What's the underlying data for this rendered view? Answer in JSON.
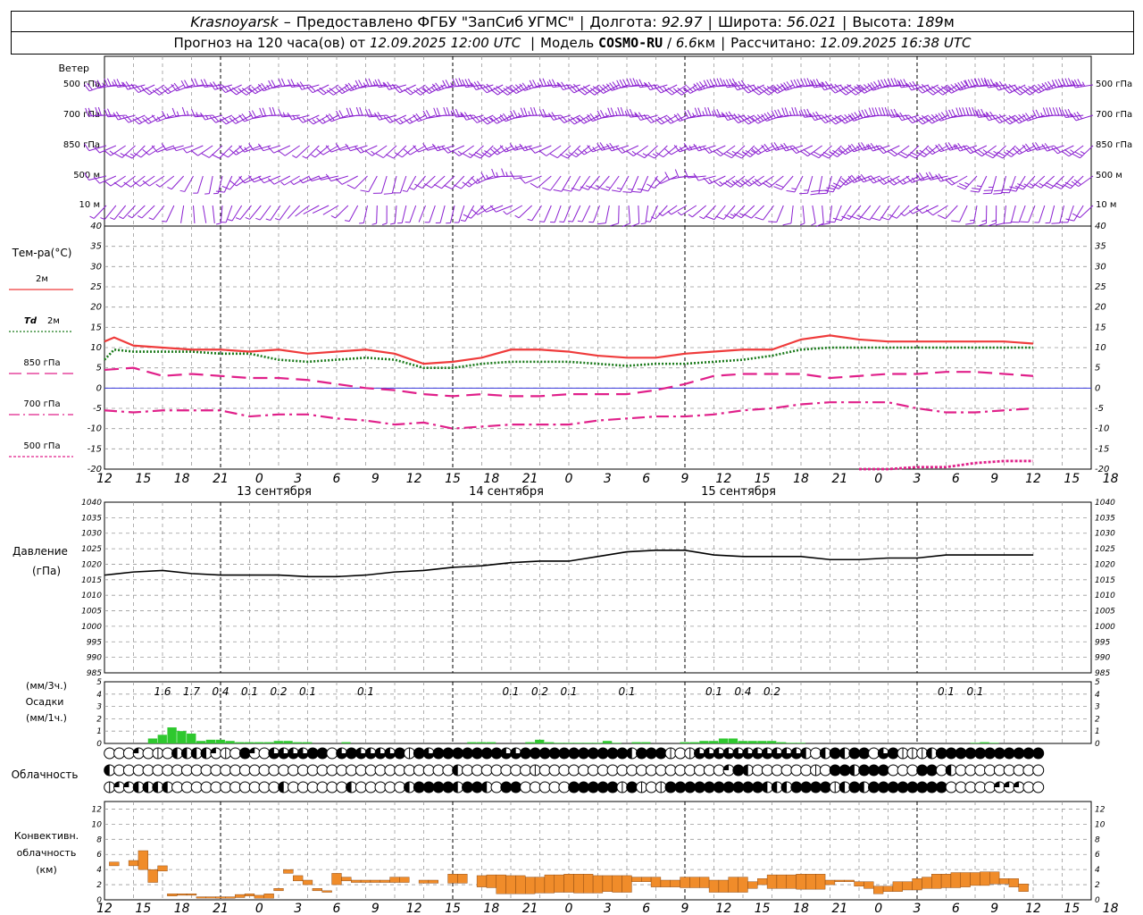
{
  "header": {
    "city": "Krasnoyarsk",
    "dash": "–",
    "provider": "Предоставлено ФГБУ \"ЗапСиб УГМС\"",
    "lon_label": "Долгота:",
    "lon_value": "92.97",
    "lat_label": "Широта:",
    "lat_value": "56.021",
    "alt_label": "Высота:",
    "alt_value": "189",
    "alt_unit": "м",
    "forecast_label": "Прогноз на 120 часа(ов) от",
    "forecast_from": "12.09.2025 12:00 UTC",
    "model_label": "Модель",
    "model_name": "COSMO-RU",
    "model_res": "6.6",
    "model_res_unit": "км",
    "calc_label": "Рассчитано:",
    "calc_time": "12.09.2025 16:38 UTC"
  },
  "colors": {
    "t2m": "#ef3b3b",
    "td2m": "#1a7a1a",
    "t850": "#e0208a",
    "t700": "#e0208a",
    "t500": "#e0208a",
    "wind": "#8a1fd0",
    "zero_line": "#3a3adc",
    "precip": "#2ec82e",
    "convective": "#f08c2a",
    "pressure": "#000000"
  },
  "x_axis": {
    "hour_ticks": [
      "12",
      "15",
      "18",
      "21",
      "0",
      "3",
      "6",
      "9",
      "12",
      "15",
      "18",
      "21",
      "0",
      "3",
      "6",
      "9",
      "12",
      "15",
      "18",
      "21",
      "0",
      "3",
      "6",
      "9",
      "12",
      "15",
      "18"
    ],
    "date_labels": [
      "13 сентября",
      "14 сентября",
      "15 сентября"
    ]
  },
  "wind_panel": {
    "title": "Ветер",
    "levels": [
      "500 гПа",
      "700 гПа",
      "850 гПа",
      "500 м",
      "10 м"
    ]
  },
  "temp_panel": {
    "title": "Тем-ра(°С)",
    "legend": [
      {
        "label": "2м",
        "style": "solid"
      },
      {
        "label_italic": "Td",
        "label": "2м",
        "style": "dotted"
      },
      {
        "label": "850 гПа",
        "style": "dashed"
      },
      {
        "label": "700 гПа",
        "style": "dashdot"
      },
      {
        "label": "500 гПа",
        "style": "densedot"
      }
    ],
    "yticks": [
      "40",
      "35",
      "30",
      "25",
      "20",
      "15",
      "10",
      "5",
      "0",
      "-5",
      "-10",
      "-15",
      "-20"
    ]
  },
  "pressure_panel": {
    "title": "Давление",
    "unit": "(гПа)",
    "yticks": [
      "1040",
      "1035",
      "1030",
      "1025",
      "1020",
      "1015",
      "1010",
      "1005",
      "1000",
      "995",
      "990",
      "985"
    ]
  },
  "precip_panel": {
    "unit3": "(мм/3ч.)",
    "title": "Осадки",
    "unit1": "(мм/1ч.)",
    "yticks": [
      "5",
      "4",
      "3",
      "2",
      "1",
      "0"
    ],
    "labels": [
      {
        "h": 6,
        "text": "1.6"
      },
      {
        "h": 9,
        "text": "1.7"
      },
      {
        "h": 12,
        "text": "0.4"
      },
      {
        "h": 15,
        "text": "0.1"
      },
      {
        "h": 18,
        "text": "0.2"
      },
      {
        "h": 21,
        "text": "0.1"
      },
      {
        "h": 27,
        "text": "0.1"
      },
      {
        "h": 42,
        "text": "0.1"
      },
      {
        "h": 45,
        "text": "0.2"
      },
      {
        "h": 48,
        "text": "0.1"
      },
      {
        "h": 54,
        "text": "0.1"
      },
      {
        "h": 63,
        "text": "0.1"
      },
      {
        "h": 66,
        "text": "0.4"
      },
      {
        "h": 69,
        "text": "0.2"
      },
      {
        "h": 87,
        "text": "0.1"
      },
      {
        "h": 90,
        "text": "0.1"
      }
    ]
  },
  "cloud_panel": {
    "title": "Облачность"
  },
  "conv_panel": {
    "title1": "Конвективн.",
    "title2": "облачность",
    "unit": "(км)",
    "yticks": [
      "12",
      "10",
      "8",
      "6",
      "4",
      "2",
      "0"
    ]
  },
  "chart_data": [
    {
      "type": "line",
      "title": "Тем-ра(°С)",
      "x_unit": "hours from 12.09.2025 12:00 UTC",
      "ylim": [
        -20,
        40
      ],
      "series": [
        {
          "name": "2м",
          "x": [
            0,
            1,
            3,
            6,
            9,
            12,
            15,
            18,
            21,
            24,
            27,
            30,
            33,
            36,
            39,
            42,
            45,
            48,
            51,
            54,
            57,
            60,
            63,
            66,
            69,
            72,
            75,
            78,
            81,
            84,
            87,
            90,
            93,
            96
          ],
          "values": [
            11.5,
            12.5,
            10.5,
            10,
            9.5,
            9.5,
            9,
            9.5,
            8.5,
            9,
            9.5,
            8.5,
            6,
            6.5,
            7.5,
            9.5,
            9.5,
            9,
            8,
            7.5,
            7.5,
            8.5,
            9,
            9.5,
            9.5,
            12,
            13,
            12,
            11.5,
            11.5,
            11.5,
            11.5,
            11.5,
            11
          ]
        },
        {
          "name": "Td 2м",
          "x": [
            0,
            1,
            3,
            6,
            9,
            12,
            15,
            18,
            21,
            24,
            27,
            30,
            33,
            36,
            39,
            42,
            45,
            48,
            51,
            54,
            57,
            60,
            63,
            66,
            69,
            72,
            75,
            78,
            81,
            84,
            87,
            90,
            93,
            96
          ],
          "values": [
            7,
            9.5,
            9,
            9,
            9,
            8.5,
            8.5,
            7,
            6.5,
            7,
            7.5,
            7,
            5,
            5,
            6,
            6.5,
            6.5,
            6.5,
            6,
            5.5,
            6,
            6,
            6.5,
            7,
            8,
            9.5,
            10,
            10,
            10,
            10,
            10,
            10,
            10,
            10
          ]
        },
        {
          "name": "850 гПа",
          "x": [
            0,
            3,
            6,
            9,
            12,
            15,
            18,
            21,
            24,
            27,
            30,
            33,
            36,
            39,
            42,
            45,
            48,
            51,
            54,
            57,
            60,
            63,
            66,
            69,
            72,
            75,
            78,
            81,
            84,
            87,
            90,
            93,
            96
          ],
          "values": [
            4.5,
            5,
            3,
            3.5,
            3,
            2.5,
            2.5,
            2,
            1,
            0,
            -0.5,
            -1.5,
            -2,
            -1.5,
            -2,
            -2,
            -1.5,
            -1.5,
            -1.5,
            -0.5,
            1,
            3,
            3.5,
            3.5,
            3.5,
            2.5,
            3,
            3.5,
            3.5,
            4,
            4,
            3.5,
            3
          ]
        },
        {
          "name": "700 гПа",
          "x": [
            0,
            3,
            6,
            9,
            12,
            15,
            18,
            21,
            24,
            27,
            30,
            33,
            36,
            39,
            42,
            45,
            48,
            51,
            54,
            57,
            60,
            63,
            66,
            69,
            72,
            75,
            78,
            81,
            84,
            87,
            90,
            93,
            96
          ],
          "values": [
            -5.5,
            -6,
            -5.5,
            -5.5,
            -5.5,
            -7,
            -6.5,
            -6.5,
            -7.5,
            -8,
            -9,
            -8.5,
            -10,
            -9.5,
            -9,
            -9,
            -9,
            -8,
            -7.5,
            -7,
            -7,
            -6.5,
            -5.5,
            -5,
            -4,
            -3.5,
            -3.5,
            -3.5,
            -5,
            -6,
            -6,
            -5.5,
            -5
          ]
        },
        {
          "name": "500 гПа",
          "x": [
            78,
            81,
            84,
            87,
            90,
            93,
            96
          ],
          "values": [
            -20,
            -20,
            -19.5,
            -19.5,
            -18.5,
            -18,
            -18
          ]
        }
      ]
    },
    {
      "type": "line",
      "title": "Давление",
      "ylabel": "(гПа)",
      "ylim": [
        985,
        1040
      ],
      "series": [
        {
          "name": "Давление",
          "x": [
            0,
            3,
            6,
            9,
            12,
            15,
            18,
            21,
            24,
            27,
            30,
            33,
            36,
            39,
            42,
            45,
            48,
            51,
            54,
            57,
            60,
            63,
            66,
            69,
            72,
            75,
            78,
            81,
            84,
            87,
            90,
            93,
            96
          ],
          "values": [
            1016.5,
            1017.5,
            1018,
            1017,
            1016.5,
            1016.5,
            1016.5,
            1016,
            1016,
            1016.5,
            1017.5,
            1018,
            1019,
            1019.5,
            1020.5,
            1021,
            1021,
            1022.5,
            1024,
            1024.5,
            1024.5,
            1023,
            1022.5,
            1022.5,
            1022.5,
            1021.5,
            1021.5,
            1022,
            1022,
            1023,
            1023,
            1023,
            1023
          ]
        }
      ]
    },
    {
      "type": "bar",
      "title": "Осадки",
      "ylabel": "(мм/1ч.)",
      "ylim": [
        0,
        5
      ],
      "series": [
        {
          "name": "Осадки",
          "x": [
            5,
            6,
            7,
            8,
            9,
            10,
            11,
            12,
            13,
            14,
            15,
            16,
            17,
            18,
            19,
            20,
            21,
            25,
            38,
            39,
            40,
            44,
            45,
            46,
            47,
            48,
            49,
            50,
            51,
            52,
            53,
            55,
            56,
            60,
            61,
            62,
            63,
            64,
            65,
            66,
            67,
            68,
            69,
            70,
            71,
            72,
            90,
            91,
            92
          ],
          "values": [
            0.4,
            0.7,
            1.3,
            1.0,
            0.8,
            0.2,
            0.3,
            0.3,
            0.2,
            0.1,
            0.1,
            0.1,
            0.1,
            0.2,
            0.2,
            0.1,
            0.1,
            0.1,
            0.1,
            0.1,
            0.1,
            0.1,
            0.3,
            0.1,
            0.05,
            0.05,
            0.05,
            0.05,
            0.05,
            0.2,
            0.05,
            0.1,
            0.1,
            0.1,
            0.1,
            0.2,
            0.2,
            0.4,
            0.4,
            0.2,
            0.2,
            0.2,
            0.2,
            0.1,
            0.05,
            0.05,
            0.05,
            0.1,
            0.05
          ]
        }
      ]
    },
    {
      "type": "bar",
      "title": "Конвективн. облачность",
      "ylabel": "(км)",
      "ylim": [
        0,
        13
      ],
      "series": [
        {
          "name": "нижняя",
          "x": [
            1,
            3,
            4,
            5,
            6,
            7,
            8,
            9,
            10,
            11,
            12,
            13,
            14,
            15,
            16,
            17,
            18,
            19,
            20,
            21,
            22,
            23,
            24,
            25,
            26,
            27,
            28,
            29,
            30,
            31,
            33,
            34,
            36,
            37,
            39,
            40,
            41,
            42,
            43,
            44,
            45,
            46,
            47,
            48,
            49,
            50,
            51,
            52,
            53,
            54,
            55,
            56,
            57,
            58,
            59,
            60,
            61,
            62,
            63,
            64,
            65,
            66,
            67,
            68,
            69,
            70,
            71,
            72,
            73,
            74,
            75,
            76,
            77,
            78,
            79,
            80,
            81,
            82,
            83,
            84,
            85,
            86,
            87,
            88,
            89,
            90,
            91,
            92,
            93,
            94,
            95
          ],
          "bottom": [
            4.5,
            4.5,
            4,
            2.3,
            3.8,
            0.5,
            0.6,
            0.6,
            0.3,
            0.3,
            0.2,
            0.2,
            0.3,
            0.5,
            0.2,
            0.2,
            1.2,
            3.5,
            2.5,
            2,
            1.2,
            1,
            2,
            2.5,
            2.3,
            2.3,
            2.3,
            2.3,
            2.3,
            2.3,
            2.2,
            2.2,
            2.2,
            2.2,
            1.7,
            1.6,
            0.8,
            0.8,
            0.8,
            0.8,
            0.9,
            0.9,
            1,
            1,
            0.9,
            0.9,
            0.9,
            1.1,
            1,
            1,
            2.4,
            2.4,
            1.7,
            1.7,
            1.7,
            1.6,
            1.6,
            1.6,
            1,
            1,
            1,
            1,
            1.5,
            2,
            1.5,
            1.5,
            1.5,
            1.4,
            1.4,
            1.4,
            2,
            2.4,
            2.4,
            1.8,
            1.5,
            0.8,
            1.1,
            1.1,
            1.3,
            1.3,
            1.5,
            1.5,
            1.6,
            1.6,
            1.7,
            1.9,
            1.9,
            2.1,
            2.1,
            1.7,
            1.1
          ],
          "top": [
            5,
            5.2,
            6.5,
            4,
            4.5,
            0.8,
            0.8,
            0.8,
            0.4,
            0.4,
            0.4,
            0.4,
            0.7,
            0.8,
            0.6,
            0.8,
            1.5,
            4,
            3.2,
            2.6,
            1.5,
            1.2,
            3.5,
            3,
            2.6,
            2.6,
            2.6,
            2.6,
            3,
            3,
            2.6,
            2.6,
            3.4,
            3.4,
            3.2,
            3.3,
            3.3,
            3.2,
            3.2,
            3,
            3,
            3.3,
            3.3,
            3.4,
            3.4,
            3.4,
            3.2,
            3.2,
            3.2,
            3.2,
            3,
            3,
            3,
            2.6,
            2.6,
            3,
            3,
            3,
            2.6,
            2.6,
            3,
            3,
            2.4,
            2.8,
            3.3,
            3.3,
            3.3,
            3.4,
            3.4,
            3.4,
            2.6,
            2.6,
            2.6,
            2.4,
            2.4,
            1.8,
            1.8,
            2.4,
            2.4,
            2.8,
            3,
            3.4,
            3.4,
            3.6,
            3.6,
            3.6,
            3.7,
            3.7,
            2.8,
            2.8,
            2.1
          ]
        }
      ]
    }
  ],
  "cloud_rows": {
    "upper": "fffqfwfhhhhqwfbqfeeeebbfebeeeebwbebbbbbbbeebbbbbbbbbbbhbbbwfweeeeeeeeeeehfhbhbbfebwwwhbbbbbbbbbbb",
    "middle": "hfffffffffffffffffffffffffffffffffffhfffffffwfffffffffffffffffffqbhffffffwfbbhbbbfffbbfhfffffffff",
    "lower": "wqqhhhhfffffffffffhffffffhfffffhbbbbhbbhfbbfffffbbbbbwbwfwbbbbbbbbbbhhhbbbbwhbhbbbbbbbbfffffqqqff"
  }
}
